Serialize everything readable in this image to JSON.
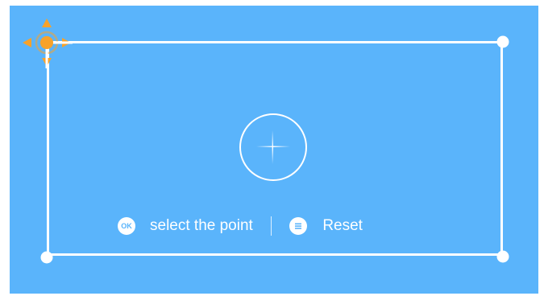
{
  "colors": {
    "background": "#5ab4fb",
    "accent": "#f7a22b",
    "line": "#ffffff"
  },
  "icons": {
    "move_handle": "move-arrows-icon",
    "ok": "ok-icon",
    "menu": "menu-lines-icon",
    "target": "crosshair-icon"
  },
  "controls": {
    "ok_glyph": "OK",
    "select_label": "select the point",
    "reset_label": "Reset"
  }
}
